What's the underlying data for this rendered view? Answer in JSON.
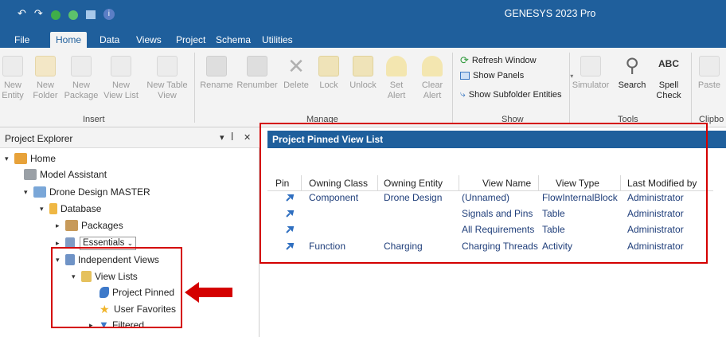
{
  "window": {
    "title": "GENESYS 2023 Pro"
  },
  "tabs": [
    "File",
    "Home",
    "Data",
    "Views",
    "Project",
    "Schema",
    "Utilities"
  ],
  "ribbon": {
    "insert": {
      "group_label": "Insert",
      "buttons": [
        {
          "line1": "New",
          "line2": "Entity"
        },
        {
          "line1": "New",
          "line2": "Folder"
        },
        {
          "line1": "New",
          "line2": "Package"
        },
        {
          "line1": "New",
          "line2": "View List"
        },
        {
          "line1": "New Table",
          "line2": "View"
        }
      ]
    },
    "manage": {
      "group_label": "Manage",
      "buttons": [
        {
          "line1": "Rename",
          "line2": ""
        },
        {
          "line1": "Renumber",
          "line2": ""
        },
        {
          "line1": "Delete",
          "line2": ""
        },
        {
          "line1": "Lock",
          "line2": ""
        },
        {
          "line1": "Unlock",
          "line2": ""
        },
        {
          "line1": "Set",
          "line2": "Alert"
        },
        {
          "line1": "Clear",
          "line2": "Alert"
        }
      ]
    },
    "show": {
      "group_label": "Show",
      "items": [
        "Refresh Window",
        "Show Panels",
        "Show Subfolder Entities"
      ]
    },
    "tools": {
      "group_label": "Tools",
      "buttons": [
        {
          "line1": "Simulator",
          "line2": ""
        },
        {
          "line1": "Search",
          "line2": ""
        },
        {
          "line1": "Spell",
          "line2": "Check"
        }
      ]
    },
    "clipboard": {
      "group_label": "Clipbo",
      "buttons": [
        {
          "line1": "Paste",
          "line2": ""
        }
      ]
    }
  },
  "explorer": {
    "title": "Project Explorer",
    "tree": [
      {
        "label": "Home",
        "caret": "open"
      },
      {
        "label": "Model Assistant",
        "caret": "none"
      },
      {
        "label": "Drone Design MASTER",
        "caret": "open"
      },
      {
        "label": "Database",
        "caret": "open"
      },
      {
        "label": "Packages",
        "caret": "closed"
      },
      {
        "label": "Essentials",
        "caret": "closed"
      },
      {
        "label": "Independent Views",
        "caret": "open"
      },
      {
        "label": "View Lists",
        "caret": "open"
      },
      {
        "label": "Project Pinned",
        "caret": "none"
      },
      {
        "label": "User Favorites",
        "caret": "none"
      },
      {
        "label": "Filtered",
        "caret": "closed"
      }
    ]
  },
  "panel": {
    "title": "Project Pinned View List",
    "columns": [
      "Pin",
      "Owning Class",
      "Owning Entity",
      "View Name",
      "View Type",
      "Last Modified by"
    ],
    "rows": [
      {
        "owning_class": "Component",
        "owning_entity": "Drone Design",
        "view_name": "(Unnamed)",
        "view_type": "FlowInternalBlock",
        "modified_by": "Administrator"
      },
      {
        "owning_class": "",
        "owning_entity": "",
        "view_name": "Signals and Pins",
        "view_type": "Table",
        "modified_by": "Administrator"
      },
      {
        "owning_class": "",
        "owning_entity": "",
        "view_name": "All Requirements",
        "view_type": "Table",
        "modified_by": "Administrator"
      },
      {
        "owning_class": "Function",
        "owning_entity": "Charging",
        "view_name": "Charging Threads",
        "view_type": "Activity",
        "modified_by": "Administrator"
      }
    ]
  },
  "colors": {
    "title_bar": "#1f5f9c",
    "highlight_box": "#d40000",
    "link_text": "#1f3e7a"
  }
}
